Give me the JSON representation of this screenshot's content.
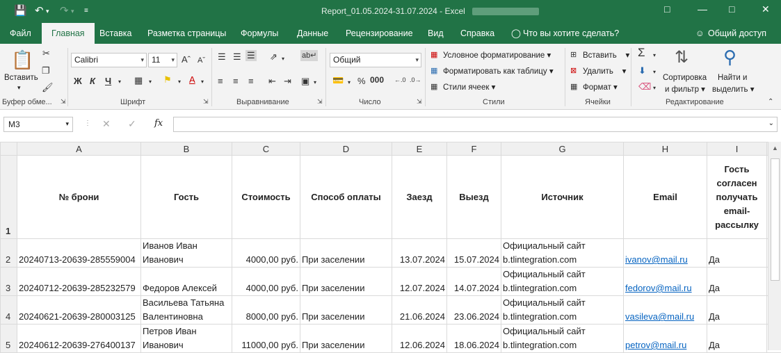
{
  "window": {
    "title": "Report_01.05.2024-31.07.2024  -  Excel"
  },
  "menu": {
    "tabs": [
      "Файл",
      "Главная",
      "Вставка",
      "Разметка страницы",
      "Формулы",
      "Данные",
      "Рецензирование",
      "Вид",
      "Справка"
    ],
    "tell_me": "Что вы хотите сделать?",
    "share": "Общий доступ"
  },
  "ribbon": {
    "clipboard": {
      "paste": "Вставить",
      "label": "Буфер обме..."
    },
    "font": {
      "name": "Calibri",
      "size": "11",
      "label": "Шрифт",
      "bold": "Ж",
      "italic": "К",
      "underline": "Ч"
    },
    "alignment": {
      "label": "Выравнивание"
    },
    "number": {
      "format": "Общий",
      "label": "Число",
      "percent": "%"
    },
    "styles": {
      "cond": "Условное форматирование",
      "table": "Форматировать как таблицу",
      "cell": "Стили ячеек",
      "label": "Стили"
    },
    "cells": {
      "insert": "Вставить",
      "delete": "Удалить",
      "format": "Формат",
      "label": "Ячейки"
    },
    "editing": {
      "sort1": "Сортировка",
      "sort2": "и фильтр",
      "find1": "Найти и",
      "find2": "выделить",
      "label": "Редактирование"
    }
  },
  "formula": {
    "namebox": "M3",
    "content": ""
  },
  "columns": [
    "A",
    "B",
    "C",
    "D",
    "E",
    "F",
    "G",
    "H",
    "I"
  ],
  "header_row": {
    "num": "1",
    "cells": [
      "№ брони",
      "Гость",
      "Стоимость",
      "Способ оплаты",
      "Заезд",
      "Выезд",
      "Источник",
      "Email",
      "Гость согласен получать email-рассылку"
    ]
  },
  "rows": [
    {
      "num": "2",
      "id": "20240713-20639-285559004",
      "guest": "Иванов Иван Иванович",
      "cost": "4000,00 руб.",
      "pay": "При заселении",
      "in": "13.07.2024",
      "out": "15.07.2024",
      "source": "Официальный сайт b.tlintegration.com",
      "email": "ivanov@mail.ru",
      "agree": "Да"
    },
    {
      "num": "3",
      "id": "20240712-20639-285232579",
      "guest": "Федоров Алексей",
      "cost": "4000,00 руб.",
      "pay": "При заселении",
      "in": "12.07.2024",
      "out": "14.07.2024",
      "source": "Официальный сайт b.tlintegration.com",
      "email": "fedorov@mail.ru",
      "agree": "Да"
    },
    {
      "num": "4",
      "id": "20240621-20639-280003125",
      "guest": "Васильева Татьяна Валентиновна",
      "cost": "8000,00 руб.",
      "pay": "При заселении",
      "in": "21.06.2024",
      "out": "23.06.2024",
      "source": "Официальный сайт b.tlintegration.com",
      "email": "vasileva@mail.ru",
      "agree": "Да"
    },
    {
      "num": "5",
      "id": "20240612-20639-276400137",
      "guest": "Петров Иван Иванович",
      "cost": "11000,00 руб.",
      "pay": "При заселении",
      "in": "12.06.2024",
      "out": "18.06.2024",
      "source": "Официальный сайт b.tlintegration.com",
      "email": "petrov@mail.ru",
      "agree": "Да"
    }
  ]
}
